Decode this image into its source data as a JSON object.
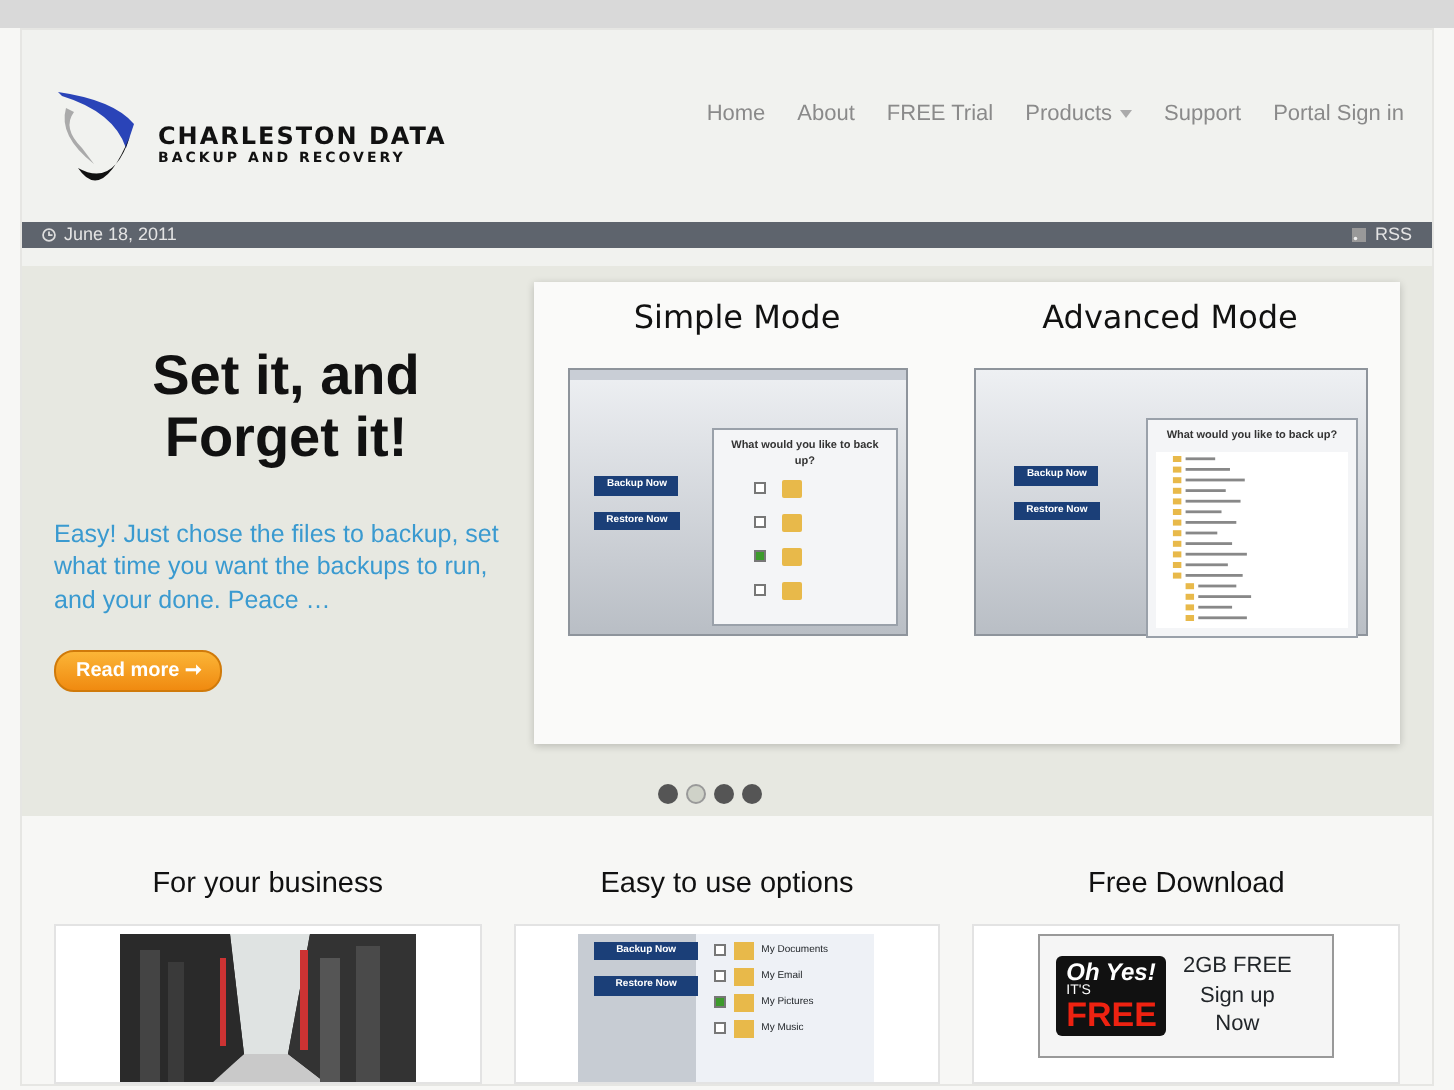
{
  "logo": {
    "line1": "CHARLESTON DATA",
    "line2": "BACKUP AND RECOVERY"
  },
  "nav": [
    {
      "label": "Home",
      "dropdown": false
    },
    {
      "label": "About",
      "dropdown": false
    },
    {
      "label": "FREE Trial",
      "dropdown": false
    },
    {
      "label": "Products",
      "dropdown": true
    },
    {
      "label": "Support",
      "dropdown": false
    },
    {
      "label": "Portal Sign in",
      "dropdown": false
    }
  ],
  "date_bar": {
    "date": "June 18, 2011",
    "rss": "RSS"
  },
  "slider": {
    "headline": "Set it, and Forget it!",
    "text": "Easy! Just chose the files to backup, set what time you want the backups to run, and your done. Peace …",
    "button": "Read more ➞",
    "panels": [
      {
        "title": "Simple Mode",
        "app": {
          "kind": "simple",
          "buttons": [
            "Backup Now",
            "Restore Now"
          ],
          "question": "What would you like to back up?",
          "items": [
            {
              "checked": false
            },
            {
              "checked": false
            },
            {
              "checked": true
            },
            {
              "checked": false
            }
          ]
        }
      },
      {
        "title": "Advanced Mode",
        "app": {
          "kind": "advanced",
          "buttons": [
            "Backup Now",
            "Restore Now"
          ],
          "question": "What would you like to back up?"
        }
      }
    ],
    "dots": [
      {
        "selected": false
      },
      {
        "selected": true
      },
      {
        "selected": false
      },
      {
        "selected": false
      }
    ]
  },
  "features": [
    {
      "title": "For your business",
      "kind": "picture"
    },
    {
      "title": "Easy to use options",
      "kind": "app",
      "buttons": [
        "Backup Now",
        "Restore Now"
      ],
      "items": [
        {
          "label": "My Documents",
          "checked": false
        },
        {
          "label": "My Email",
          "checked": false
        },
        {
          "label": "My Pictures",
          "checked": true
        },
        {
          "label": "My Music",
          "checked": false
        }
      ]
    },
    {
      "title": "Free Download",
      "kind": "ad",
      "badge": [
        "Oh Yes!",
        "IT'S",
        "FREE"
      ],
      "lines": [
        "2GB FREE",
        "Sign up",
        "Now"
      ]
    }
  ]
}
